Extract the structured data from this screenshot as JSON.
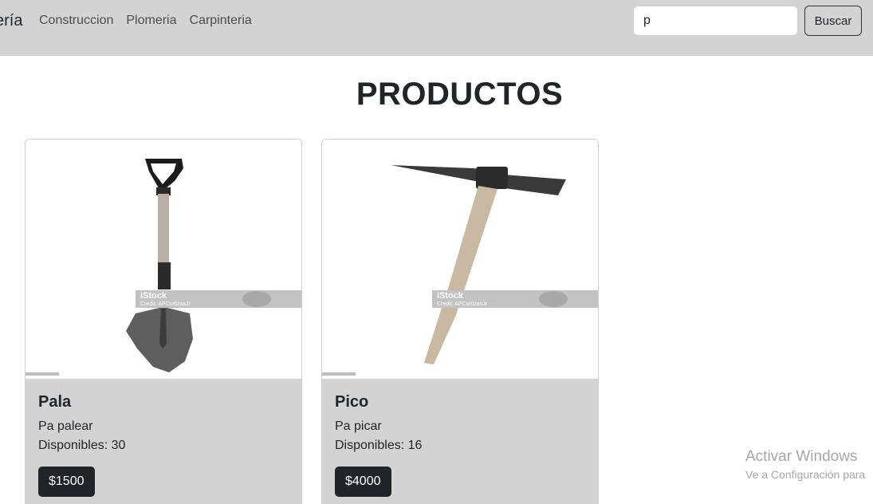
{
  "navbar": {
    "brand": "ería",
    "links": [
      "Construccion",
      "Plomeria",
      "Carpinteria"
    ],
    "search": {
      "value": "p",
      "placeholder": ""
    },
    "search_button": "Buscar"
  },
  "page": {
    "title": "PRODUCTOS"
  },
  "products": [
    {
      "name": "Pala",
      "description": "Pa palear",
      "stock": "Disponibles: 30",
      "price": "$1500",
      "image_watermark": "iStock",
      "image_credit": "Credit: APCortizasJr"
    },
    {
      "name": "Pico",
      "description": "Pa picar",
      "stock": "Disponibles: 16",
      "price": "$4000",
      "image_watermark": "iStock",
      "image_credit": "Credit: APCortizasJr"
    }
  ],
  "os_overlay": {
    "title": "Activar Windows",
    "subtitle": "Ve a Configuración para"
  },
  "colors": {
    "navbar_bg": "#d3d3d3",
    "card_body_bg": "#d3d3d3",
    "price_button_bg": "#212529"
  }
}
